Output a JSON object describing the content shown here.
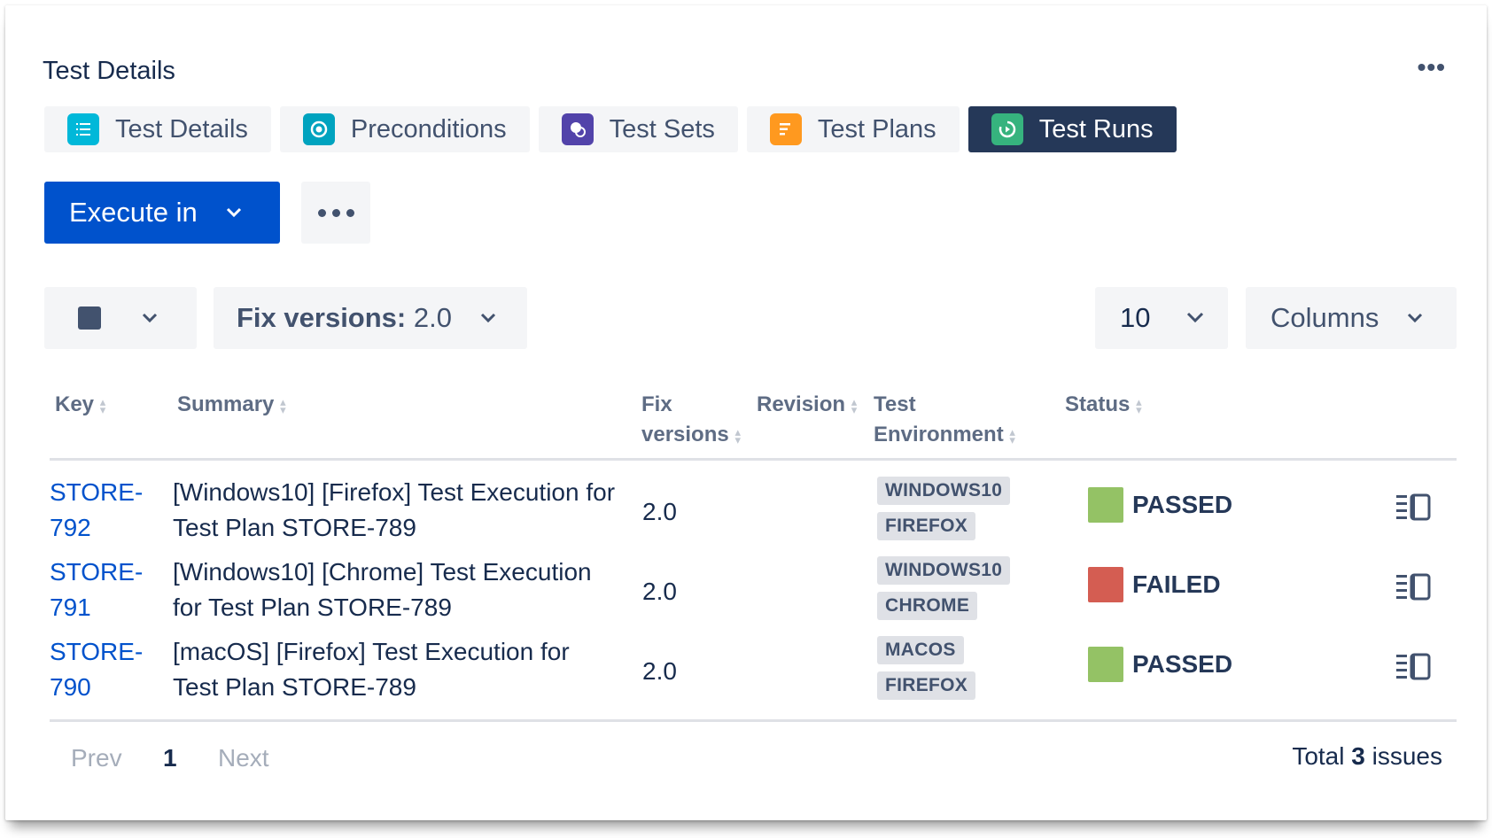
{
  "panel": {
    "title": "Test Details",
    "more_label": "•••"
  },
  "tabs": [
    {
      "label": "Test Details",
      "icon": "test-details-icon",
      "active": false
    },
    {
      "label": "Preconditions",
      "icon": "preconditions-icon",
      "active": false
    },
    {
      "label": "Test Sets",
      "icon": "test-sets-icon",
      "active": false
    },
    {
      "label": "Test Plans",
      "icon": "test-plans-icon",
      "active": false
    },
    {
      "label": "Test Runs",
      "icon": "test-runs-icon",
      "active": true
    }
  ],
  "toolbar": {
    "execute_label": "Execute in"
  },
  "filters": {
    "fix_versions_label": "Fix versions:",
    "fix_versions_value": "2.0",
    "page_size": "10",
    "columns_label": "Columns"
  },
  "table": {
    "headers": {
      "key": "Key",
      "summary": "Summary",
      "fix_line1": "Fix",
      "fix_line2": "versions",
      "revision": "Revision",
      "env_line1": "Test",
      "env_line2": "Environment",
      "status": "Status"
    },
    "rows": [
      {
        "key_line1": "STORE-",
        "key_line2": "792",
        "summary_line1": "[Windows10] [Firefox] Test Execution for",
        "summary_line2": "Test Plan STORE-789",
        "fix": "2.0",
        "env1": "WINDOWS10",
        "env2": "FIREFOX",
        "status": "PASSED",
        "status_color": "#94c265"
      },
      {
        "key_line1": "STORE-",
        "key_line2": "791",
        "summary_line1": "[Windows10] [Chrome] Test Execution",
        "summary_line2": "for Test Plan STORE-789",
        "fix": "2.0",
        "env1": "WINDOWS10",
        "env2": "CHROME",
        "status": "FAILED",
        "status_color": "#d45d52"
      },
      {
        "key_line1": "STORE-",
        "key_line2": "790",
        "summary_line1": "[macOS] [Firefox] Test Execution for",
        "summary_line2": "Test Plan STORE-789",
        "fix": "2.0",
        "env1": "MACOS",
        "env2": "FIREFOX",
        "status": "PASSED",
        "status_color": "#94c265"
      }
    ]
  },
  "pagination": {
    "prev": "Prev",
    "current": "1",
    "next": "Next"
  },
  "footer": {
    "total_prefix": "Total",
    "total_count": "3",
    "total_suffix": "issues"
  }
}
